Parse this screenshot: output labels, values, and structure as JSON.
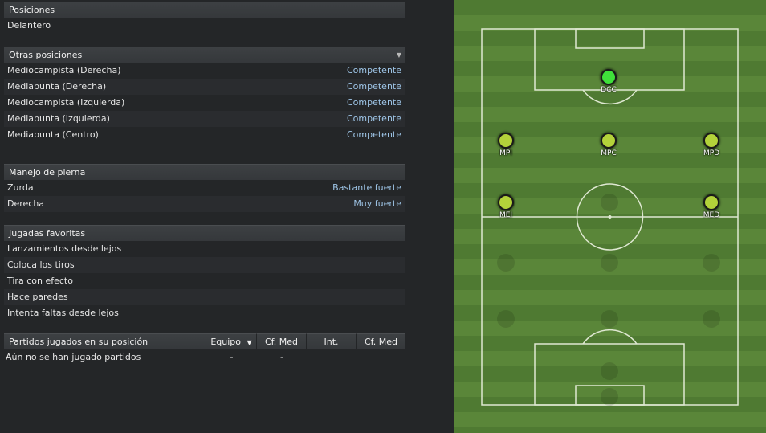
{
  "positions": {
    "header": "Posiciones",
    "current": "Delantero"
  },
  "other_positions": {
    "header": "Otras posiciones",
    "items": [
      {
        "label": "Mediocampista (Derecha)",
        "value": "Competente"
      },
      {
        "label": "Mediapunta (Derecha)",
        "value": "Competente"
      },
      {
        "label": "Mediocampista (Izquierda)",
        "value": "Competente"
      },
      {
        "label": "Mediapunta (Izquierda)",
        "value": "Competente"
      },
      {
        "label": "Mediapunta (Centro)",
        "value": "Competente"
      }
    ]
  },
  "footedness": {
    "header": "Manejo de pierna",
    "items": [
      {
        "label": "Zurda",
        "value": "Bastante fuerte"
      },
      {
        "label": "Derecha",
        "value": "Muy fuerte"
      }
    ]
  },
  "favorite_moves": {
    "header": "Jugadas favoritas",
    "items": [
      "Lanzamientos desde lejos",
      "Coloca los tiros",
      "Tira con efecto",
      "Hace paredes",
      "Intenta faltas desde lejos"
    ]
  },
  "matches_table": {
    "columns": [
      "Partidos jugados en su posición",
      "Equipo",
      "Cf. Med",
      "Int.",
      "Cf. Med"
    ],
    "empty_text": "Aún no se han jugado partidos",
    "dash1": "-",
    "dash2": "-"
  },
  "pitch": {
    "players": [
      {
        "code": "DCC",
        "primary": true
      },
      {
        "code": "MPI",
        "primary": false
      },
      {
        "code": "MPC",
        "primary": false
      },
      {
        "code": "MPD",
        "primary": false
      },
      {
        "code": "MEI",
        "primary": false
      },
      {
        "code": "MED",
        "primary": false
      }
    ],
    "colors": {
      "primary": "#3fe03a",
      "secondary": "#b3d23a",
      "grass_dark": "#4f7a32",
      "grass_light": "#5a8639"
    }
  }
}
